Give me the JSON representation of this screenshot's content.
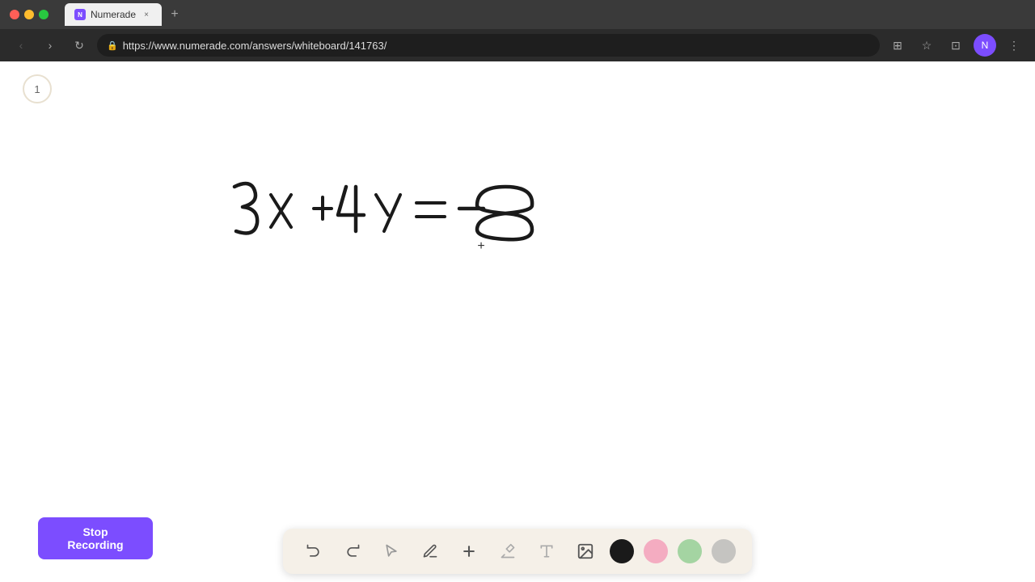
{
  "browser": {
    "title": "Numerade",
    "url": "https://www.numerade.com/answers/whiteboard/141763/",
    "tab_label": "Numerade",
    "tab_close": "×",
    "new_tab": "+"
  },
  "nav": {
    "back": "‹",
    "forward": "›",
    "refresh": "↺",
    "extensions_icon": "⊞",
    "star_icon": "☆"
  },
  "page": {
    "page_number": "1"
  },
  "toolbar": {
    "undo_label": "↺",
    "redo_label": "↻",
    "select_label": "▷",
    "pen_label": "✏",
    "plus_label": "+",
    "eraser_label": "/",
    "text_label": "A",
    "image_label": "🖼",
    "colors": [
      "#1a1a1a",
      "#f48fb1",
      "#81c784",
      "#b0b0b0"
    ]
  },
  "recording": {
    "stop_label": "Stop Recording"
  },
  "equation": {
    "text": "3x +4y = -8"
  }
}
